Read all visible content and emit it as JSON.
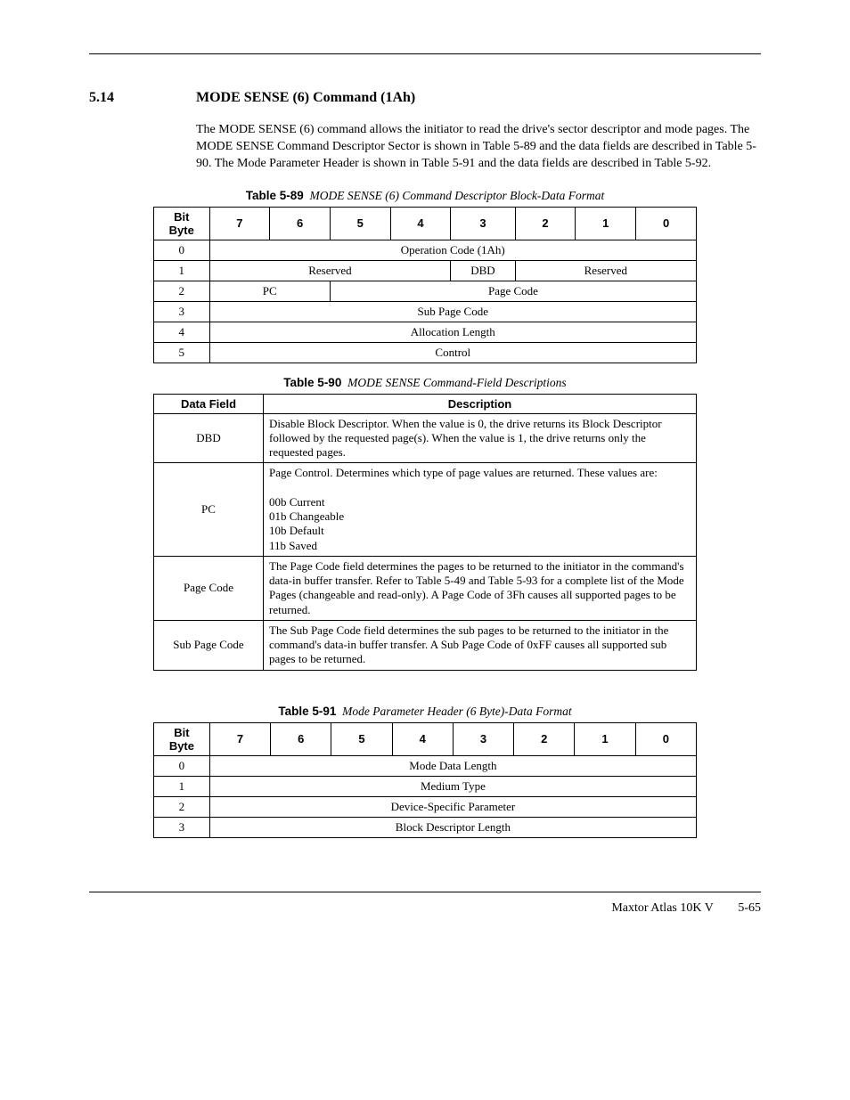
{
  "section": {
    "number": "5.14",
    "title": "MODE SENSE (6) Command (1Ah)"
  },
  "intro": "The MODE SENSE (6) command allows the initiator to read the drive's sector descriptor and mode pages. The MODE SENSE Command Descriptor Sector is shown in Table 5-89 and the data fields are described in Table 5-90. The Mode Parameter Header is shown in Table 5-91 and the data fields are described in Table 5-92.",
  "tables": {
    "t89": {
      "label": "Table 5-89",
      "title": "MODE SENSE (6) Command Descriptor Block-Data Format",
      "header": {
        "corner": "Bit\nByte",
        "bits": [
          "7",
          "6",
          "5",
          "4",
          "3",
          "2",
          "1",
          "0"
        ]
      },
      "rows": {
        "r0": {
          "byte": "0",
          "op": "Operation Code (1Ah)"
        },
        "r1": {
          "byte": "1",
          "resv1": "Reserved",
          "dbd": "DBD",
          "resv2": "Reserved"
        },
        "r2": {
          "byte": "2",
          "pc": "PC",
          "pagecode": "Page Code"
        },
        "r3": {
          "byte": "3",
          "sub": "Sub Page Code"
        },
        "r4": {
          "byte": "4",
          "alloc": "Allocation Length"
        },
        "r5": {
          "byte": "5",
          "ctrl": "Control"
        }
      }
    },
    "t90": {
      "label": "Table 5-90",
      "title": "MODE SENSE Command-Field Descriptions",
      "header": {
        "field": "Data Field",
        "desc": "Description"
      },
      "rows": {
        "dbd": {
          "field": "DBD",
          "desc": "Disable Block Descriptor. When the value is 0, the drive returns its Block Descriptor followed by the requested page(s). When the value is 1, the drive returns only the requested pages."
        },
        "pc": {
          "field": "PC",
          "intro": "Page Control. Determines which type of page values are returned. These values are:",
          "v0": "00b Current",
          "v1": "01b Changeable",
          "v2": "10b Default",
          "v3": "11b Saved"
        },
        "pagecode": {
          "field": "Page Code",
          "desc": "The Page Code field determines the pages to be returned to the initiator in the command's data-in buffer transfer. Refer to Table 5-49 and Table 5-93 for a complete list of the Mode Pages (changeable and read-only). A Page Code of 3Fh causes all supported pages to be returned."
        },
        "subpage": {
          "field": "Sub Page Code",
          "desc": "The Sub Page Code field determines the sub pages to be returned to the initiator in the command's data-in buffer transfer. A Sub Page Code of 0xFF causes all supported sub pages to be returned."
        }
      }
    },
    "t91": {
      "label": "Table 5-91",
      "title": "Mode Parameter Header (6 Byte)-Data Format",
      "header": {
        "corner": "Bit\nByte",
        "bits": [
          "7",
          "6",
          "5",
          "4",
          "3",
          "2",
          "1",
          "0"
        ]
      },
      "rows": {
        "r0": {
          "byte": "0",
          "val": "Mode Data Length"
        },
        "r1": {
          "byte": "1",
          "val": "Medium Type"
        },
        "r2": {
          "byte": "2",
          "val": "Device-Specific Parameter"
        },
        "r3": {
          "byte": "3",
          "val": "Block Descriptor Length"
        }
      }
    }
  },
  "footer": {
    "book": "Maxtor Atlas 10K V",
    "page": "5-65"
  }
}
